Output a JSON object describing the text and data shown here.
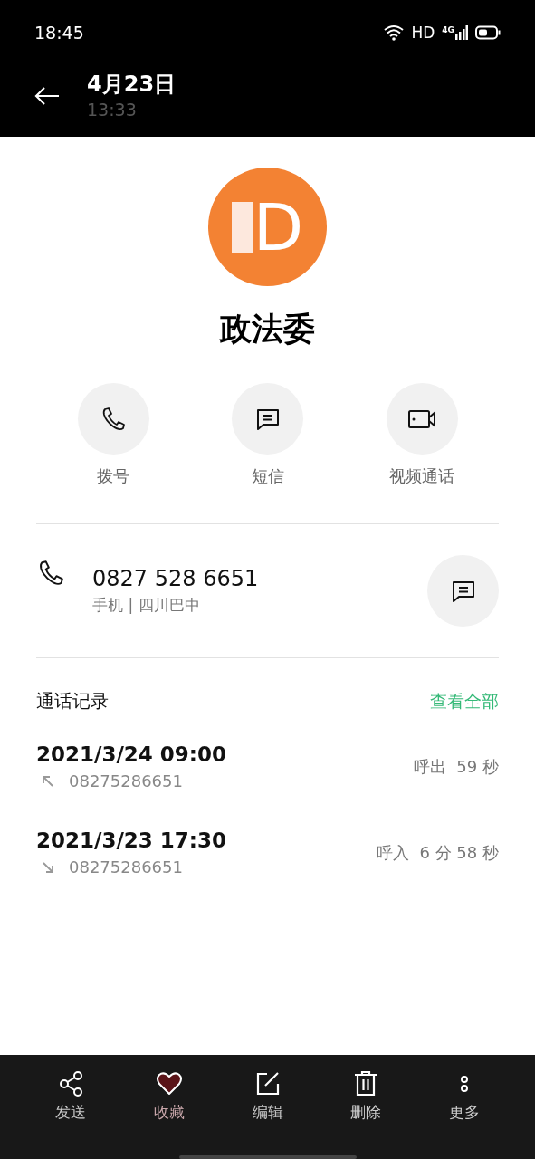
{
  "status_bar": {
    "time": "18:45",
    "network": "HD",
    "cell": "4G"
  },
  "header": {
    "title": "4月23日",
    "subtitle": "13:33"
  },
  "contact": {
    "name": "政法委",
    "initial": "D"
  },
  "actions": [
    {
      "kind": "call",
      "label": "拨号"
    },
    {
      "kind": "message",
      "label": "短信"
    },
    {
      "kind": "video",
      "label": "视频通话"
    }
  ],
  "phone": {
    "number": "0827 528 6651",
    "detail": "手机 | 四川巴中"
  },
  "call_log": {
    "title": "通话记录",
    "view_all": "查看全部",
    "entries": [
      {
        "datetime": "2021/3/24 09:00",
        "number": "08275286651",
        "kind": "outgoing",
        "summary": "呼出  59 秒"
      },
      {
        "datetime": "2021/3/23 17:30",
        "number": "08275286651",
        "kind": "incoming",
        "summary": "呼入  6 分 58 秒"
      }
    ]
  },
  "toolbar": [
    {
      "kind": "share",
      "label": "发送",
      "on": false
    },
    {
      "kind": "favorite",
      "label": "收藏",
      "on": true
    },
    {
      "kind": "edit",
      "label": "编辑",
      "on": false
    },
    {
      "kind": "delete",
      "label": "删除",
      "on": false
    },
    {
      "kind": "more",
      "label": "更多",
      "on": false
    }
  ]
}
